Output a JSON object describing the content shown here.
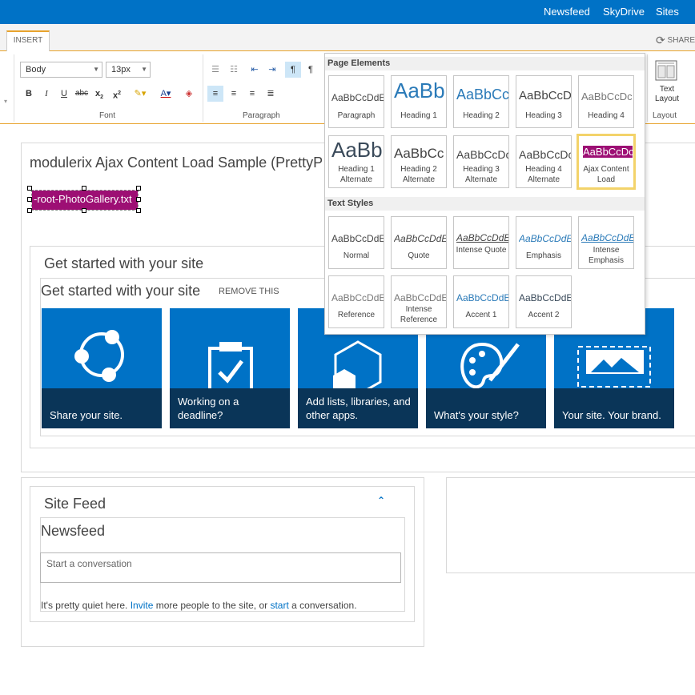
{
  "suitebar": {
    "links": [
      "Newsfeed",
      "SkyDrive",
      "Sites"
    ]
  },
  "ribbon": {
    "tab_insert": "INSERT",
    "share": "SHARE",
    "font": {
      "style": "Body",
      "size": "13px",
      "group_label": "Font"
    },
    "paragraph": {
      "group_label": "Paragraph"
    },
    "layout": {
      "text_layout": "Text Layout",
      "group_label": "Layout"
    }
  },
  "page": {
    "title": "modulerix Ajax Content Load Sample (PrettyP",
    "chip": "-root-PhotoGallery.txt",
    "get_started_outer": "Get started with your site",
    "get_started_inner": "Get started with your site",
    "remove_this": "REMOVE THIS",
    "tiles": [
      {
        "caption": "Share your site.",
        "icon": "share-icon"
      },
      {
        "caption": "Working on a deadline?",
        "icon": "clipboard-check-icon"
      },
      {
        "caption": "Add lists, libraries, and other apps.",
        "icon": "hexagon-icon"
      },
      {
        "caption": "What's your style?",
        "icon": "palette-icon"
      },
      {
        "caption": "Your site. Your brand.",
        "icon": "picture-frame-icon"
      }
    ],
    "site_feed": "Site Feed",
    "newsfeed": "Newsfeed",
    "conversation_placeholder": "Start a conversation",
    "quiet": {
      "pre": "It's pretty quiet here. ",
      "invite": "Invite",
      "mid": " more people to the site, or ",
      "start": "start",
      "post": " a conversation."
    }
  },
  "gallery": {
    "page_elements_header": "Page Elements",
    "text_styles_header": "Text Styles",
    "page_elements": [
      {
        "sample": "AaBbCcDdE",
        "label": "Paragraph"
      },
      {
        "sample": "AaBb",
        "label": "Heading 1"
      },
      {
        "sample": "AaBbCc",
        "label": "Heading 2"
      },
      {
        "sample": "AaBbCcDc",
        "label": "Heading 3"
      },
      {
        "sample": "AaBbCcDc",
        "label": "Heading 4"
      },
      {
        "sample": "AaBb",
        "label": "Heading 1 Alternate"
      },
      {
        "sample": "AaBbCc",
        "label": "Heading 2 Alternate"
      },
      {
        "sample": "AaBbCcDc",
        "label": "Heading 3 Alternate"
      },
      {
        "sample": "AaBbCcDc",
        "label": "Heading 4 Alternate"
      },
      {
        "sample": "AaBbCcDc",
        "label": "Ajax Content Load"
      }
    ],
    "text_styles": [
      {
        "sample": "AaBbCcDdE",
        "label": "Normal"
      },
      {
        "sample": "AaBbCcDdE",
        "label": "Quote"
      },
      {
        "sample": "AaBbCcDdE",
        "label": "Intense Quote"
      },
      {
        "sample": "AaBbCcDdE",
        "label": "Emphasis"
      },
      {
        "sample": "AaBbCcDdE",
        "label": "Intense Emphasis"
      },
      {
        "sample": "AaBbCcDdE",
        "label": "Reference"
      },
      {
        "sample": "AaBbCcDdE",
        "label": "Intense Reference"
      },
      {
        "sample": "AaBbCcDdE",
        "label": "Accent 1"
      },
      {
        "sample": "AaBbCcDdE",
        "label": "Accent 2"
      }
    ]
  },
  "colors": {
    "suitebar": "#0072c6",
    "tile": "#0072c6",
    "tile_band": "#0a3558",
    "chip": "#9d0f74",
    "ribbon_accent": "#e8a32d"
  }
}
